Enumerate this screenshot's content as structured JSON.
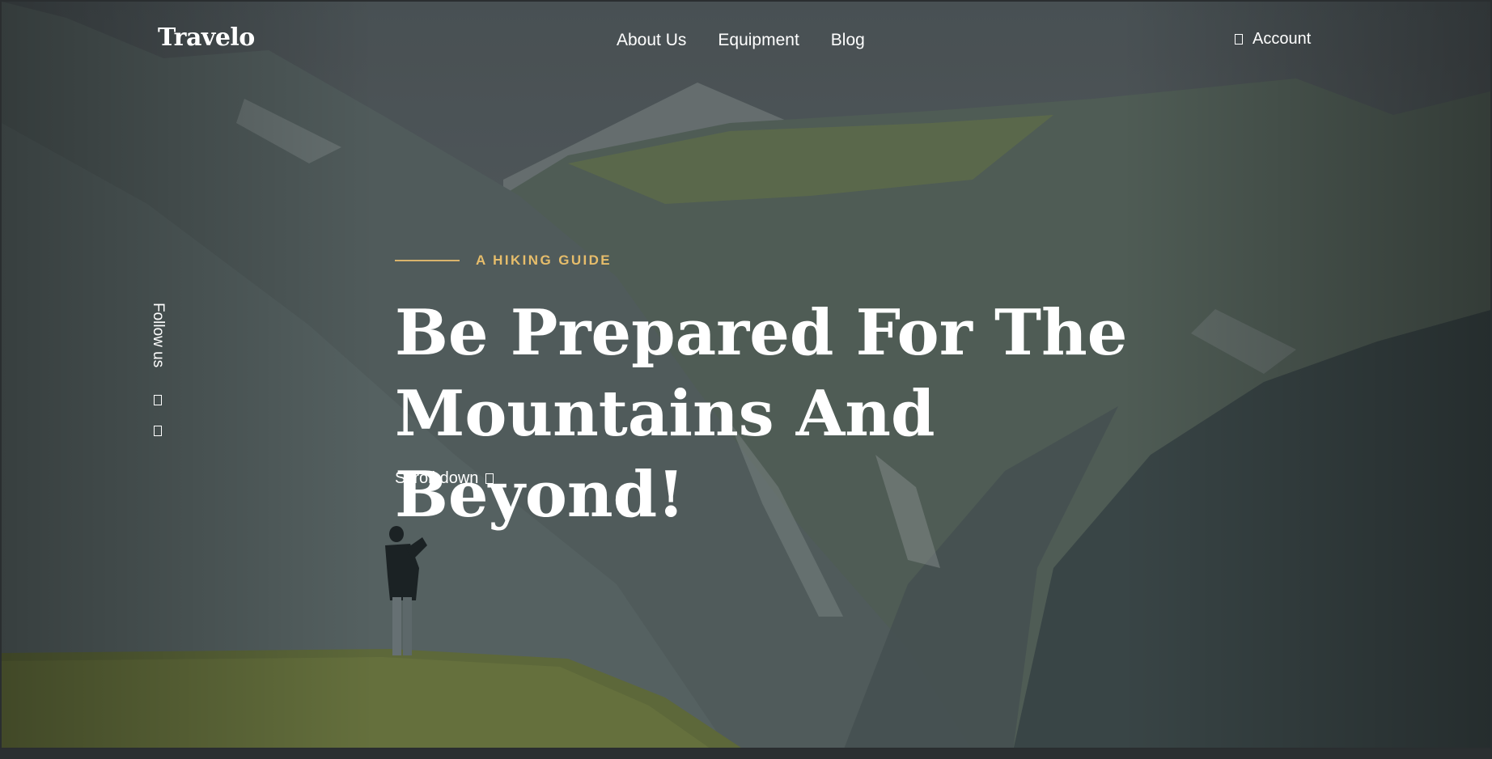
{
  "brand": {
    "logo": "Travelo"
  },
  "nav": {
    "links": [
      "About Us",
      "Equipment",
      "Blog"
    ],
    "account_label": "Account"
  },
  "hero": {
    "eyebrow": "A HIKING GUIDE",
    "headline_line1": "Be Prepared For The",
    "headline_line2": "Mountains And Beyond!",
    "scroll_label": "Scroll down"
  },
  "side": {
    "follow_label": "Follow us"
  },
  "colors": {
    "accent": "#e6bd6b",
    "text": "#ffffff",
    "overlay": "#3c4a4e"
  }
}
